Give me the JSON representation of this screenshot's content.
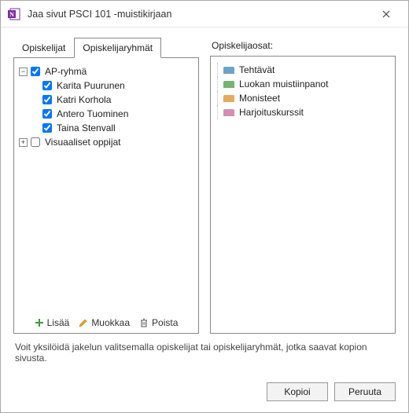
{
  "window": {
    "title": "Jaa sivut PSCI 101 -muistikirjaan"
  },
  "tabs": {
    "students": "Opiskelijat",
    "groups": "Opiskelijaryhmät"
  },
  "groups": [
    {
      "name": "AP-ryhmä",
      "checked": true,
      "expanded": true,
      "members": [
        {
          "name": "Karita Puurunen",
          "checked": true
        },
        {
          "name": "Katri Korhola",
          "checked": true
        },
        {
          "name": "Antero Tuominen",
          "checked": true
        },
        {
          "name": "Taina Stenvall",
          "checked": true
        }
      ]
    },
    {
      "name": "Visuaaliset oppijat",
      "checked": false,
      "expanded": false,
      "members": []
    }
  ],
  "actions": {
    "add": "Lisää",
    "edit": "Muokkaa",
    "delete": "Poista"
  },
  "sections_title": "Opiskelijaosat:",
  "sections": [
    {
      "label": "Tehtävät",
      "color": "#6ea2c9"
    },
    {
      "label": "Luokan muistiinpanot",
      "color": "#74b56e"
    },
    {
      "label": "Monisteet",
      "color": "#e6a95e"
    },
    {
      "label": "Harjoituskurssit",
      "color": "#d48fb0"
    }
  ],
  "hint": "Voit yksilöidä jakelun valitsemalla opiskelijat tai opiskelijaryhmät, jotka saavat kopion sivusta.",
  "buttons": {
    "copy": "Kopioi",
    "cancel": "Peruuta"
  }
}
